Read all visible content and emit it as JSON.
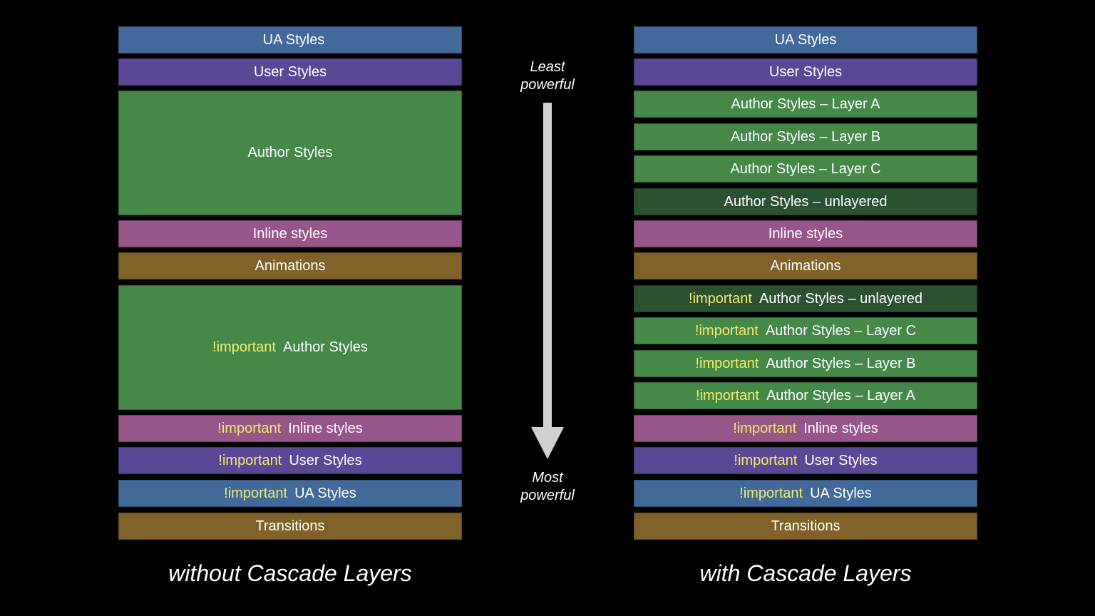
{
  "colors": {
    "ua": "#43699b",
    "user": "#5a4896",
    "author": "#46874a",
    "unlayered": "#2a5230",
    "inline": "#97568a",
    "animation": "#7f6228",
    "important_text": "#f2ee6a",
    "arrow": "#d0d0d0"
  },
  "left": {
    "caption": "without Cascade Layers",
    "boxes": [
      {
        "important": "",
        "label": "UA Styles",
        "kind": "ua"
      },
      {
        "important": "",
        "label": "User Styles",
        "kind": "user"
      },
      {
        "important": "",
        "label": "Author Styles",
        "kind": "author"
      },
      {
        "important": "",
        "label": "Inline styles",
        "kind": "inline"
      },
      {
        "important": "",
        "label": "Animations",
        "kind": "animation"
      },
      {
        "important": "!important",
        "label": "Author Styles",
        "kind": "author"
      },
      {
        "important": "!important",
        "label": "Inline styles",
        "kind": "inline"
      },
      {
        "important": "!important",
        "label": "User Styles",
        "kind": "user"
      },
      {
        "important": "!important",
        "label": "UA Styles",
        "kind": "ua"
      },
      {
        "important": "",
        "label": "Transitions",
        "kind": "animation"
      }
    ]
  },
  "right": {
    "caption": "with Cascade Layers",
    "boxes": [
      {
        "important": "",
        "label": "UA Styles",
        "kind": "ua"
      },
      {
        "important": "",
        "label": "User Styles",
        "kind": "user"
      },
      {
        "important": "",
        "label": "Author Styles – Layer A",
        "kind": "author"
      },
      {
        "important": "",
        "label": "Author Styles – Layer B",
        "kind": "author"
      },
      {
        "important": "",
        "label": "Author Styles – Layer C",
        "kind": "author"
      },
      {
        "important": "",
        "label": "Author Styles – unlayered",
        "kind": "unlayered"
      },
      {
        "important": "",
        "label": "Inline styles",
        "kind": "inline"
      },
      {
        "important": "",
        "label": "Animations",
        "kind": "animation"
      },
      {
        "important": "!important",
        "label": "Author Styles – unlayered",
        "kind": "unlayered"
      },
      {
        "important": "!important",
        "label": "Author Styles – Layer C",
        "kind": "author"
      },
      {
        "important": "!important",
        "label": "Author Styles – Layer B",
        "kind": "author"
      },
      {
        "important": "!important",
        "label": "Author Styles – Layer A",
        "kind": "author"
      },
      {
        "important": "!important",
        "label": "Inline styles",
        "kind": "inline"
      },
      {
        "important": "!important",
        "label": "User Styles",
        "kind": "user"
      },
      {
        "important": "!important",
        "label": "UA Styles",
        "kind": "ua"
      },
      {
        "important": "",
        "label": "Transitions",
        "kind": "animation"
      }
    ]
  },
  "arrow": {
    "top_label_line1": "Least",
    "top_label_line2": "powerful",
    "bottom_label_line1": "Most",
    "bottom_label_line2": "powerful"
  }
}
